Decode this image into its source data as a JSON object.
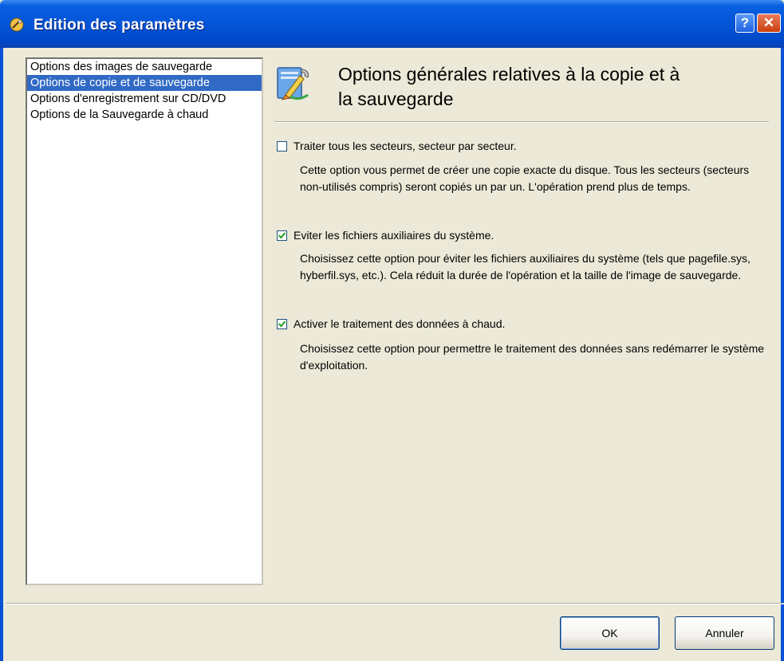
{
  "window": {
    "title": "Edition des paramètres",
    "help_glyph": "?",
    "close_glyph": "✕"
  },
  "sidebar": {
    "items": [
      {
        "label": "Options des images de sauvegarde"
      },
      {
        "label": "Options de copie et de sauvegarde"
      },
      {
        "label": "Options d'enregistrement sur CD/DVD"
      },
      {
        "label": "Options de la Sauvegarde à chaud"
      }
    ],
    "selected_index": 1
  },
  "panel": {
    "heading_line1": "Options générales relatives à la copie et à",
    "heading_line2": "la sauvegarde",
    "options": [
      {
        "label": "Traiter tous les secteurs, secteur par secteur.",
        "checked": false,
        "description": "Cette option vous permet de créer une copie exacte du disque. Tous les secteurs (secteurs non-utilisés compris) seront copiés un par un. L'opération prend plus de temps."
      },
      {
        "label": "Eviter les fichiers auxiliaires du système.",
        "checked": true,
        "description": "Choisissez cette option pour éviter les fichiers auxiliaires du système (tels que pagefile.sys, hyberfil.sys, etc.). Cela réduit la durée de l'opération et la taille de l'image de sauvegarde."
      },
      {
        "label": "Activer le traitement des données à chaud.",
        "checked": true,
        "description": "Choisissez cette option pour permettre le traitement des données sans redémarrer le système d'exploitation."
      }
    ]
  },
  "buttons": {
    "ok_label": "OK",
    "cancel_label": "Annuler"
  },
  "icons": {
    "title": "settings-tools-icon",
    "header": "edit-settings-icon",
    "help": "help-icon",
    "close": "close-icon",
    "checkmark": "checkmark-icon"
  },
  "colors": {
    "titlebar": "#0454d8",
    "selection": "#316ac5",
    "dialog_bg": "#ece9d8",
    "close_button": "#c9410f"
  }
}
